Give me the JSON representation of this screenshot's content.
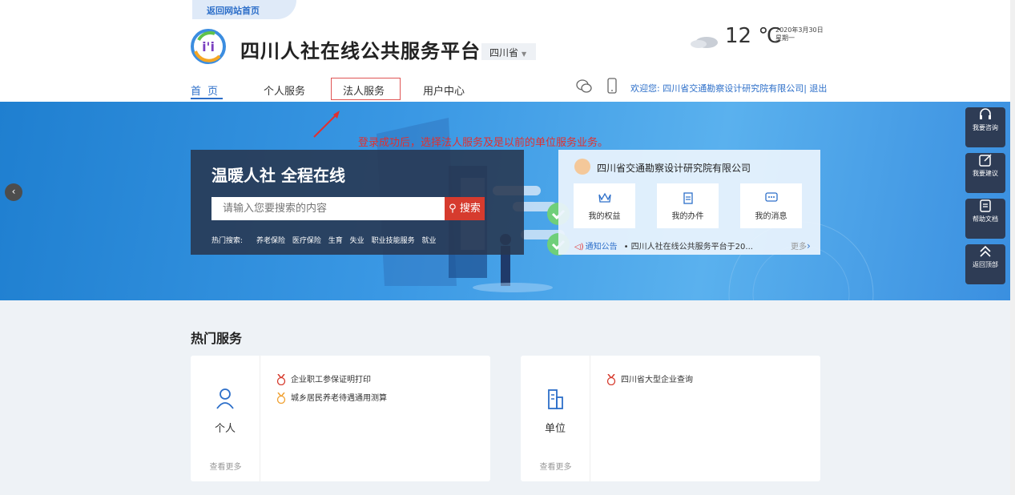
{
  "header": {
    "back_link": "返回网站首页",
    "title": "四川人社在线公共服务平台",
    "region": "四川省",
    "temperature": "12 ℃",
    "date": "2020年3月30日",
    "weekday": "星期一",
    "welcome": "欢迎您: 四川省交通勘察设计研究院有限公司|",
    "logout": "退出"
  },
  "nav": {
    "home": "首页",
    "personal": "个人服务",
    "corporate": "法人服务",
    "user_center": "用户中心"
  },
  "banner": {
    "annotation": "登录成功后，选择法人服务及是以前的单位服务业务。",
    "slogan": "温暖人社 全程在线",
    "search_placeholder": "请输入您要搜索的内容",
    "search_button": "搜索",
    "hot_label": "热门搜索:",
    "hot_links": [
      "养老保险",
      "医疗保险",
      "生育",
      "失业",
      "职业技能服务",
      "就业"
    ]
  },
  "user_panel": {
    "company": "四川省交通勘察设计研究院有限公司",
    "quick_links": [
      "我的权益",
      "我的办件",
      "我的消息"
    ],
    "notice_label": "通知公告",
    "notice_text": "• 四川人社在线公共服务平台于20...",
    "more": "更多"
  },
  "float_bar": [
    "我要咨询",
    "我要建议",
    "帮助文档",
    "返回顶部"
  ],
  "hot_services": {
    "title": "热门服务",
    "personal": {
      "label": "个人",
      "more": "查看更多",
      "items": [
        "企业职工参保证明打印",
        "城乡居民养老待遇通用测算"
      ]
    },
    "corporate": {
      "label": "单位",
      "more": "查看更多",
      "items": [
        "四川省大型企业查询"
      ]
    }
  },
  "colors": {
    "primary": "#2d6fc9",
    "search_button": "#d63b2e",
    "annotation": "#e03030",
    "float_bar": "#2e3c55"
  }
}
